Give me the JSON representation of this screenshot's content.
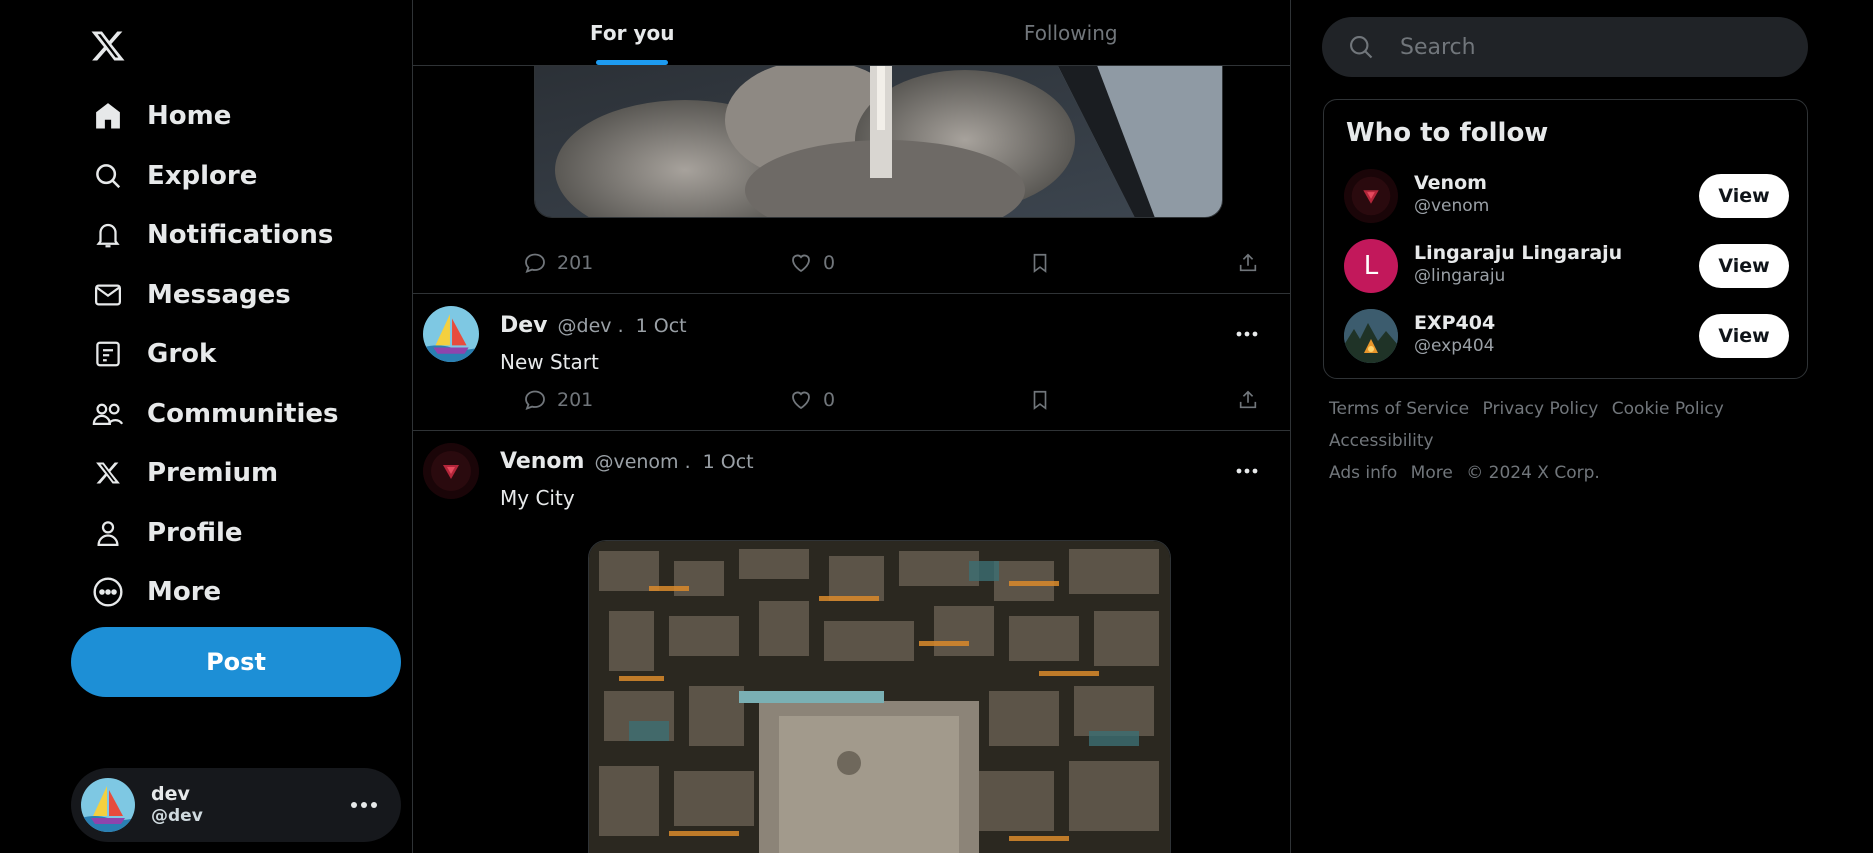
{
  "nav": {
    "items": [
      {
        "label": "Home",
        "icon": "home-icon"
      },
      {
        "label": "Explore",
        "icon": "search-icon"
      },
      {
        "label": "Notifications",
        "icon": "bell-icon"
      },
      {
        "label": "Messages",
        "icon": "mail-icon"
      },
      {
        "label": "Grok",
        "icon": "grok-icon"
      },
      {
        "label": "Communities",
        "icon": "people-icon"
      },
      {
        "label": "Premium",
        "icon": "x-logo-icon"
      },
      {
        "label": "Profile",
        "icon": "person-icon"
      },
      {
        "label": "More",
        "icon": "more-circle-icon"
      }
    ],
    "post_label": "Post"
  },
  "account": {
    "name": "dev",
    "handle": "@dev"
  },
  "tabs": [
    {
      "label": "For you",
      "active": true
    },
    {
      "label": "Following",
      "active": false
    }
  ],
  "feed": {
    "post0": {
      "replies": "201",
      "likes": "0"
    },
    "post1": {
      "name": "Dev",
      "handle": "@dev .",
      "date": "1 Oct",
      "text": "New Start",
      "replies": "201",
      "likes": "0"
    },
    "post2": {
      "name": "Venom",
      "handle": "@venom .",
      "date": "1 Oct",
      "text": "My City"
    }
  },
  "search": {
    "placeholder": "Search"
  },
  "who_to_follow": {
    "title": "Who to follow",
    "users": [
      {
        "name": "Venom",
        "handle": "@venom",
        "button": "View"
      },
      {
        "name": "Lingaraju Lingaraju",
        "handle": "@lingaraju",
        "initial": "L",
        "button": "View",
        "avatar_color": "#c2185b"
      },
      {
        "name": "EXP404",
        "handle": "@exp404",
        "button": "View"
      }
    ]
  },
  "footer": {
    "links": [
      "Terms of Service",
      "Privacy Policy",
      "Cookie Policy",
      "Accessibility",
      "Ads info",
      "More"
    ],
    "copyright": "© 2024 X Corp."
  },
  "colors": {
    "accent": "#1d9bf0",
    "post_button": "#1d8fd6",
    "background": "#000000"
  }
}
